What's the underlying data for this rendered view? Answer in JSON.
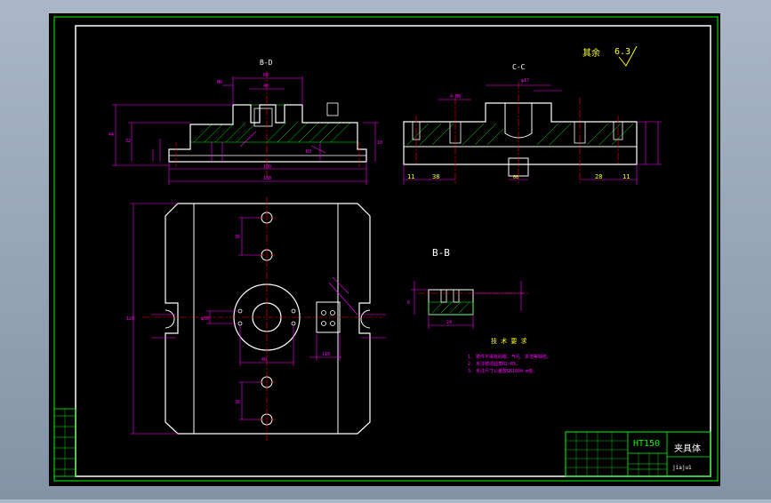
{
  "sections": {
    "bd": "B-D",
    "cc": "C-C",
    "bb": "B-B"
  },
  "roughness_note": {
    "label": "其余",
    "value": "6.3"
  },
  "dims_bd": {
    "d60": "60",
    "d40": "40",
    "d32": "32",
    "d44": "44",
    "d10": "10",
    "d180": "180",
    "d100": "100",
    "m": "M8",
    "r": "R3"
  },
  "dims_cc": {
    "d11a": "11",
    "d38": "38",
    "d28": "28",
    "d11b": "11",
    "d60": "60",
    "d4x": "4-M8",
    "dphi": "φ17"
  },
  "dims_plan": {
    "d120": "120",
    "d36a": "36",
    "d36b": "36",
    "d110": "110",
    "d40": "40",
    "dphi": "φ50"
  },
  "dims_bb": {
    "d24": "24",
    "d6": "6"
  },
  "tech_req": {
    "title": "技 术 要 求",
    "items": [
      "1. 铸件不得有砂眼、气孔、夹渣等缺陷。",
      "2. 未注铸造圆角R2~R5。",
      "3. 未注尺寸公差按GB1804-m级。"
    ]
  },
  "title_block": {
    "material": "HT150",
    "part_name": "夹具体",
    "drawing_code": "jiaju1",
    "left_col": [
      "",
      "",
      "",
      "",
      "",
      ""
    ]
  },
  "colors": {
    "frame": "#ffffff",
    "outline": "#ffffff",
    "dim": "#ff00ff",
    "center": "#ff0000",
    "hatch": "#00ff00",
    "title": "#00ff00",
    "text": "#ffff00"
  }
}
